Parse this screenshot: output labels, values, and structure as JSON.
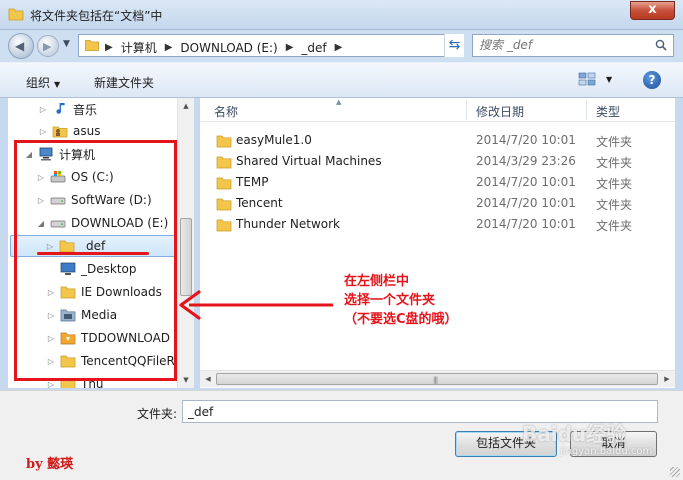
{
  "window": {
    "title": "将文件夹包括在“文档”中",
    "close_label": "x"
  },
  "address": {
    "breadcrumbs": [
      "计算机",
      "DOWNLOAD (E:)",
      "_def"
    ],
    "search_placeholder": "搜索 _def"
  },
  "toolbar": {
    "organize_label": "组织",
    "new_folder_label": "新建文件夹",
    "help_label": "?"
  },
  "sidebar": {
    "items": [
      {
        "label": "音乐",
        "icon": "music-icon"
      },
      {
        "label": "asus",
        "icon": "user-folder-icon"
      },
      {
        "label": "计算机",
        "icon": "computer-icon"
      },
      {
        "label": "OS (C:)",
        "icon": "os-drive-icon"
      },
      {
        "label": "SoftWare (D:)",
        "icon": "drive-icon"
      },
      {
        "label": "DOWNLOAD (E:)",
        "icon": "drive-icon"
      },
      {
        "label": "_def",
        "icon": "folder-icon"
      },
      {
        "label": "_Desktop",
        "icon": "desktop-icon"
      },
      {
        "label": "IE Downloads",
        "icon": "folder-icon"
      },
      {
        "label": "Media",
        "icon": "media-folder-icon"
      },
      {
        "label": "TDDOWNLOAD",
        "icon": "tddownload-icon"
      },
      {
        "label": "TencentQQFileR",
        "icon": "folder-icon"
      },
      {
        "label": "Thu",
        "icon": "folder-icon"
      }
    ]
  },
  "filelist": {
    "columns": {
      "name": "名称",
      "date": "修改日期",
      "type": "类型"
    },
    "rows": [
      {
        "name": "easyMule1.0",
        "date": "2014/7/20 10:01",
        "type": "文件夹"
      },
      {
        "name": "Shared Virtual Machines",
        "date": "2014/3/29 23:26",
        "type": "文件夹"
      },
      {
        "name": "TEMP",
        "date": "2014/7/20 10:01",
        "type": "文件夹"
      },
      {
        "name": "Tencent",
        "date": "2014/7/20 10:01",
        "type": "文件夹"
      },
      {
        "name": "Thunder Network",
        "date": "2014/7/20 10:01",
        "type": "文件夹"
      }
    ]
  },
  "bottom": {
    "folder_label": "文件夹:",
    "folder_value": "_def",
    "include_button": "包括文件夹",
    "cancel_button": "取消"
  },
  "annotation": {
    "lines": [
      "在左侧栏中",
      "选择一个文件夹",
      "（不要选C盘的哦）"
    ],
    "byline": "by 懿瑛",
    "watermark": "Baidu经验",
    "watermark_sub": "jingyan.baidu.com"
  },
  "colors": {
    "accent_red": "#e4141b",
    "folder_yellow": "#f2c64b",
    "selection_blue": "#cfe6fa"
  }
}
